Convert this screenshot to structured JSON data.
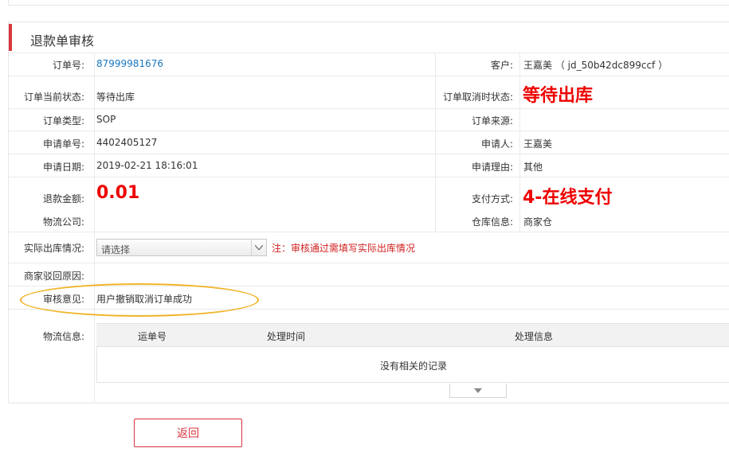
{
  "page": {
    "title": "退款单审核"
  },
  "form": {
    "order_no": {
      "label": "订单号:",
      "value": "87999981676"
    },
    "customer": {
      "label": "客户:",
      "value": "王嘉美 （ jd_50b42dc899ccf ）"
    },
    "current_status": {
      "label": "订单当前状态:",
      "value": "等待出库"
    },
    "cancel_status": {
      "label": "订单取消时状态:",
      "value": "等待出库"
    },
    "order_type": {
      "label": "订单类型:",
      "value": "SOP"
    },
    "order_source": {
      "label": "订单来源:",
      "value": ""
    },
    "apply_no": {
      "label": "申请单号:",
      "value": "4402405127"
    },
    "applicant": {
      "label": "申请人:",
      "value": "王嘉美"
    },
    "apply_date": {
      "label": "申请日期:",
      "value": "2019-02-21 18:16:01"
    },
    "apply_reason": {
      "label": "申请理由:",
      "value": "其他"
    },
    "refund_amount": {
      "label": "退款金额:",
      "value": "0.01"
    },
    "pay_method": {
      "label": "支付方式:",
      "value": "4-在线支付"
    },
    "logistics_company": {
      "label": "物流公司:",
      "value": ""
    },
    "warehouse": {
      "label": "仓库信息:",
      "value": "商家仓"
    },
    "actual_outbound": {
      "label": "实际出库情况:",
      "selected": "请选择",
      "note": "注：审核通过需填写实际出库情况"
    },
    "reject_reason": {
      "label": "商家驳回原因:",
      "value": ""
    },
    "review_opinion": {
      "label": "审核意见:",
      "value": "用户撤销取消订单成功"
    },
    "logistics_info": {
      "label": "物流信息:",
      "columns": [
        "运单号",
        "处理时间",
        "处理信息"
      ],
      "empty_text": "没有相关的记录"
    }
  },
  "actions": {
    "back_label": "返回"
  },
  "colors": {
    "accent": "#d9363e",
    "highlight_red": "#ee0000",
    "link_blue": "#1a78c2",
    "annotation_yellow": "#f0b429"
  }
}
